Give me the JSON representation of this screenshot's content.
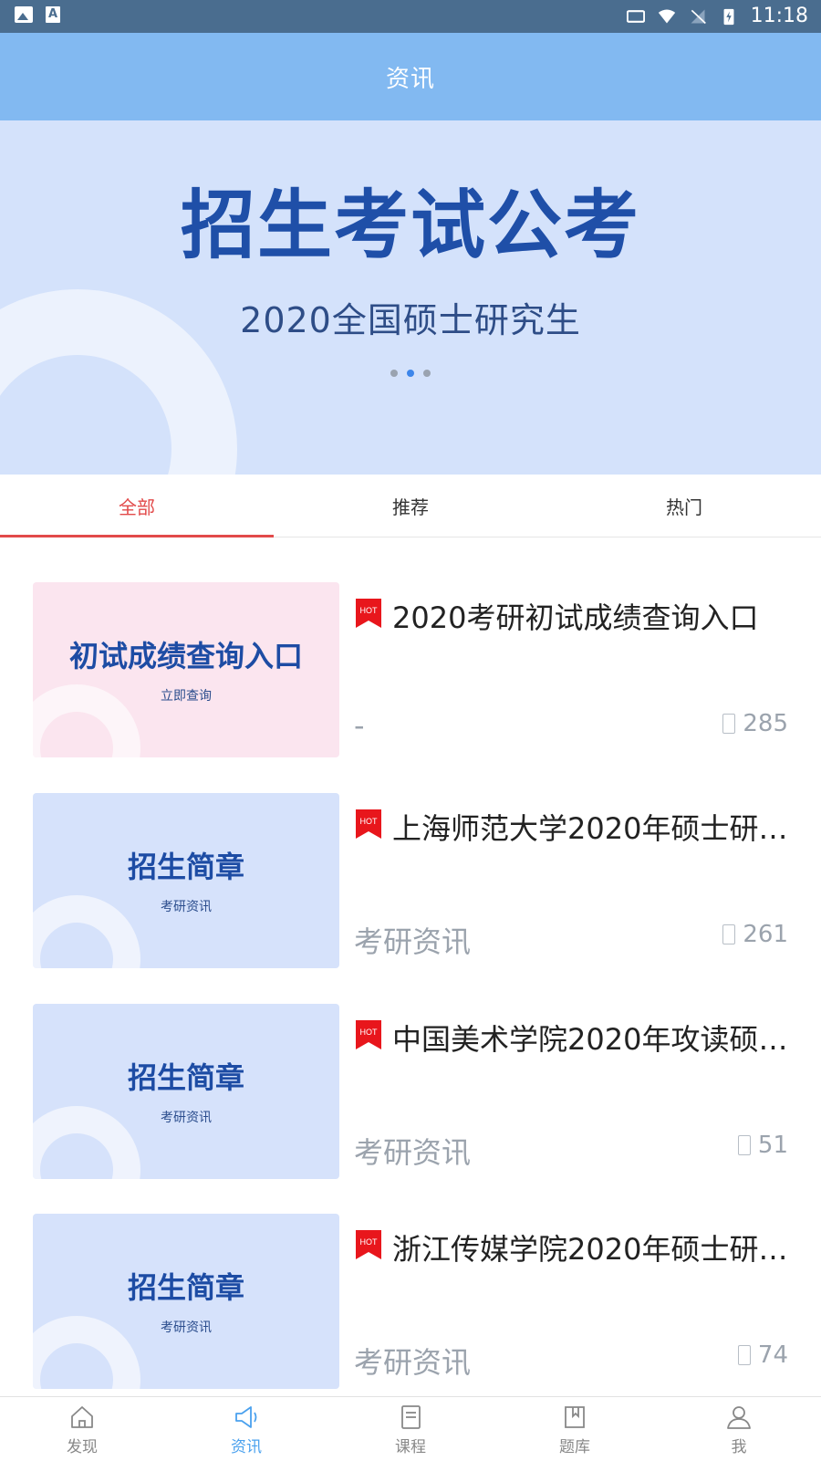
{
  "status_bar": {
    "time": "11:18"
  },
  "header": {
    "title": "资讯"
  },
  "banner": {
    "title": "招生考试公考",
    "subtitle": "2020全国硕士研究生",
    "active_dot": 1,
    "dot_count": 3
  },
  "tabs": [
    {
      "label": "全部",
      "active": true
    },
    {
      "label": "推荐",
      "active": false
    },
    {
      "label": "热门",
      "active": false
    }
  ],
  "news": [
    {
      "thumb_title": "初试成绩查询入口",
      "thumb_sub": "立即查询",
      "thumb_color": "#fbe5ef",
      "badge": "HOT",
      "title": "2020考研初试成绩查询入口",
      "category": "-",
      "views": "285"
    },
    {
      "thumb_title": "招生简章",
      "thumb_sub": "考研资讯",
      "thumb_color": "#d6e2fb",
      "badge": "HOT",
      "title": "上海师范大学2020年硕士研…",
      "category": "考研资讯",
      "views": "261"
    },
    {
      "thumb_title": "招生简章",
      "thumb_sub": "考研资讯",
      "thumb_color": "#d6e2fb",
      "badge": "HOT",
      "title": "中国美术学院2020年攻读硕…",
      "category": "考研资讯",
      "views": "51"
    },
    {
      "thumb_title": "招生简章",
      "thumb_sub": "考研资讯",
      "thumb_color": "#d6e2fb",
      "badge": "HOT",
      "title": "浙江传媒学院2020年硕士研…",
      "category": "考研资讯",
      "views": "74"
    }
  ],
  "bottom_nav": [
    {
      "label": "发现",
      "icon": "home-icon",
      "active": false
    },
    {
      "label": "资讯",
      "icon": "megaphone-icon",
      "active": true
    },
    {
      "label": "课程",
      "icon": "book-icon",
      "active": false
    },
    {
      "label": "题库",
      "icon": "bookmark-book-icon",
      "active": false
    },
    {
      "label": "我",
      "icon": "user-icon",
      "active": false
    }
  ],
  "colors": {
    "primary": "#82b9f1",
    "tab_active": "#e24a4a",
    "nav_active": "#4aa1ee",
    "hot_badge": "#e8161c"
  }
}
